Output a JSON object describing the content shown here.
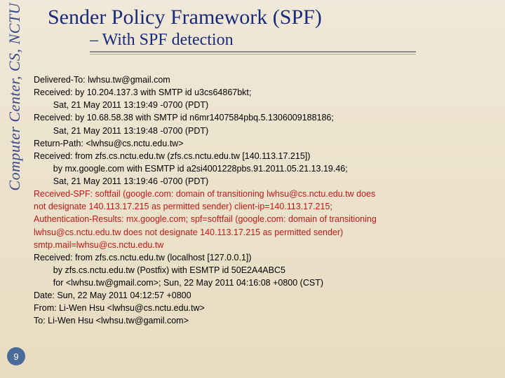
{
  "sidebar": {
    "label": "Computer Center, CS, NCTU",
    "page_number": "9"
  },
  "header": {
    "title": "Sender Policy Framework (SPF)",
    "subtitle": "– With SPF detection"
  },
  "email": {
    "l1": "Delivered-To: lwhsu.tw@gmail.com",
    "l2": "Received: by 10.204.137.3 with SMTP id u3cs64867bkt;",
    "l3": "        Sat, 21 May 2011 13:19:49 -0700 (PDT)",
    "l4": "Received: by 10.68.58.38 with SMTP id n6mr1407584pbq.5.1306009188186;",
    "l5": "        Sat, 21 May 2011 13:19:48 -0700 (PDT)",
    "l6": "Return-Path: <lwhsu@cs.nctu.edu.tw>",
    "l7": "Received: from zfs.cs.nctu.edu.tw (zfs.cs.nctu.edu.tw [140.113.17.215])",
    "l8": "        by mx.google.com with ESMTP id a2si4001228pbs.91.2011.05.21.13.19.46;",
    "l9": "        Sat, 21 May 2011 13:19:46 -0700 (PDT)",
    "l10a": "Received-SPF: softfail (google.com: domain of transitioning lwhsu@cs.nctu.edu.tw does",
    "l10b": "not designate 140.113.17.215 as permitted sender) client-ip=140.113.17.215;",
    "l11a": "Authentication-Results: mx.google.com; spf=softfail (google.com: domain of transitioning",
    "l11b": "lwhsu@cs.nctu.edu.tw does not designate 140.113.17.215 as permitted sender)",
    "l11c": "smtp.mail=lwhsu@cs.nctu.edu.tw",
    "l12": "Received: from zfs.cs.nctu.edu.tw (localhost [127.0.0.1])",
    "l13": "        by zfs.cs.nctu.edu.tw (Postfix) with ESMTP id 50E2A4ABC5",
    "l14": "        for <lwhsu.tw@gmail.com>; Sun, 22 May 2011 04:16:08 +0800 (CST)",
    "l15": "Date: Sun, 22 May 2011 04:12:57 +0800",
    "l16": "From: Li-Wen Hsu <lwhsu@cs.nctu.edu.tw>",
    "l17": "To: Li-Wen Hsu <lwhsu.tw@gamil.com>"
  }
}
